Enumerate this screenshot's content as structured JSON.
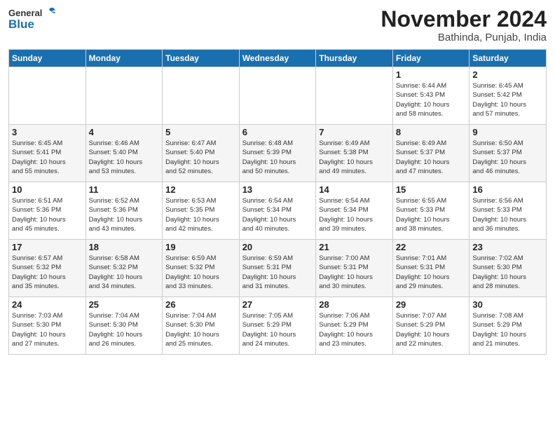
{
  "header": {
    "logo_general": "General",
    "logo_blue": "Blue",
    "month_title": "November 2024",
    "location": "Bathinda, Punjab, India"
  },
  "weekdays": [
    "Sunday",
    "Monday",
    "Tuesday",
    "Wednesday",
    "Thursday",
    "Friday",
    "Saturday"
  ],
  "weeks": [
    [
      {
        "day": "",
        "info": ""
      },
      {
        "day": "",
        "info": ""
      },
      {
        "day": "",
        "info": ""
      },
      {
        "day": "",
        "info": ""
      },
      {
        "day": "",
        "info": ""
      },
      {
        "day": "1",
        "info": "Sunrise: 6:44 AM\nSunset: 5:43 PM\nDaylight: 10 hours\nand 58 minutes."
      },
      {
        "day": "2",
        "info": "Sunrise: 6:45 AM\nSunset: 5:42 PM\nDaylight: 10 hours\nand 57 minutes."
      }
    ],
    [
      {
        "day": "3",
        "info": "Sunrise: 6:45 AM\nSunset: 5:41 PM\nDaylight: 10 hours\nand 55 minutes."
      },
      {
        "day": "4",
        "info": "Sunrise: 6:46 AM\nSunset: 5:40 PM\nDaylight: 10 hours\nand 53 minutes."
      },
      {
        "day": "5",
        "info": "Sunrise: 6:47 AM\nSunset: 5:40 PM\nDaylight: 10 hours\nand 52 minutes."
      },
      {
        "day": "6",
        "info": "Sunrise: 6:48 AM\nSunset: 5:39 PM\nDaylight: 10 hours\nand 50 minutes."
      },
      {
        "day": "7",
        "info": "Sunrise: 6:49 AM\nSunset: 5:38 PM\nDaylight: 10 hours\nand 49 minutes."
      },
      {
        "day": "8",
        "info": "Sunrise: 6:49 AM\nSunset: 5:37 PM\nDaylight: 10 hours\nand 47 minutes."
      },
      {
        "day": "9",
        "info": "Sunrise: 6:50 AM\nSunset: 5:37 PM\nDaylight: 10 hours\nand 46 minutes."
      }
    ],
    [
      {
        "day": "10",
        "info": "Sunrise: 6:51 AM\nSunset: 5:36 PM\nDaylight: 10 hours\nand 45 minutes."
      },
      {
        "day": "11",
        "info": "Sunrise: 6:52 AM\nSunset: 5:36 PM\nDaylight: 10 hours\nand 43 minutes."
      },
      {
        "day": "12",
        "info": "Sunrise: 6:53 AM\nSunset: 5:35 PM\nDaylight: 10 hours\nand 42 minutes."
      },
      {
        "day": "13",
        "info": "Sunrise: 6:54 AM\nSunset: 5:34 PM\nDaylight: 10 hours\nand 40 minutes."
      },
      {
        "day": "14",
        "info": "Sunrise: 6:54 AM\nSunset: 5:34 PM\nDaylight: 10 hours\nand 39 minutes."
      },
      {
        "day": "15",
        "info": "Sunrise: 6:55 AM\nSunset: 5:33 PM\nDaylight: 10 hours\nand 38 minutes."
      },
      {
        "day": "16",
        "info": "Sunrise: 6:56 AM\nSunset: 5:33 PM\nDaylight: 10 hours\nand 36 minutes."
      }
    ],
    [
      {
        "day": "17",
        "info": "Sunrise: 6:57 AM\nSunset: 5:32 PM\nDaylight: 10 hours\nand 35 minutes."
      },
      {
        "day": "18",
        "info": "Sunrise: 6:58 AM\nSunset: 5:32 PM\nDaylight: 10 hours\nand 34 minutes."
      },
      {
        "day": "19",
        "info": "Sunrise: 6:59 AM\nSunset: 5:32 PM\nDaylight: 10 hours\nand 33 minutes."
      },
      {
        "day": "20",
        "info": "Sunrise: 6:59 AM\nSunset: 5:31 PM\nDaylight: 10 hours\nand 31 minutes."
      },
      {
        "day": "21",
        "info": "Sunrise: 7:00 AM\nSunset: 5:31 PM\nDaylight: 10 hours\nand 30 minutes."
      },
      {
        "day": "22",
        "info": "Sunrise: 7:01 AM\nSunset: 5:31 PM\nDaylight: 10 hours\nand 29 minutes."
      },
      {
        "day": "23",
        "info": "Sunrise: 7:02 AM\nSunset: 5:30 PM\nDaylight: 10 hours\nand 28 minutes."
      }
    ],
    [
      {
        "day": "24",
        "info": "Sunrise: 7:03 AM\nSunset: 5:30 PM\nDaylight: 10 hours\nand 27 minutes."
      },
      {
        "day": "25",
        "info": "Sunrise: 7:04 AM\nSunset: 5:30 PM\nDaylight: 10 hours\nand 26 minutes."
      },
      {
        "day": "26",
        "info": "Sunrise: 7:04 AM\nSunset: 5:30 PM\nDaylight: 10 hours\nand 25 minutes."
      },
      {
        "day": "27",
        "info": "Sunrise: 7:05 AM\nSunset: 5:29 PM\nDaylight: 10 hours\nand 24 minutes."
      },
      {
        "day": "28",
        "info": "Sunrise: 7:06 AM\nSunset: 5:29 PM\nDaylight: 10 hours\nand 23 minutes."
      },
      {
        "day": "29",
        "info": "Sunrise: 7:07 AM\nSunset: 5:29 PM\nDaylight: 10 hours\nand 22 minutes."
      },
      {
        "day": "30",
        "info": "Sunrise: 7:08 AM\nSunset: 5:29 PM\nDaylight: 10 hours\nand 21 minutes."
      }
    ]
  ]
}
